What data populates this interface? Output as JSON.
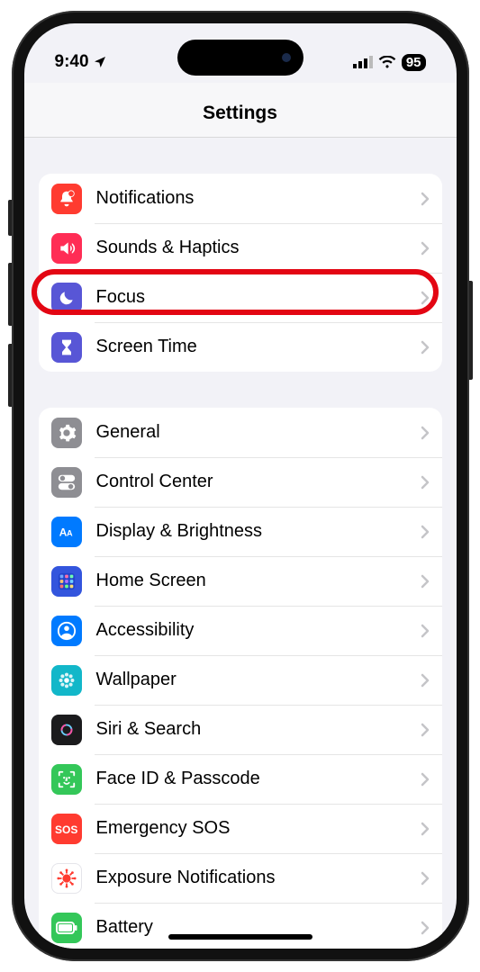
{
  "status": {
    "time": "9:40",
    "location_icon": "location-arrow",
    "battery_percent": "95"
  },
  "nav": {
    "title": "Settings"
  },
  "groups": [
    {
      "rows": [
        {
          "id": "notifications",
          "label": "Notifications",
          "icon": "bell",
          "bg": "#ff3b30"
        },
        {
          "id": "sounds",
          "label": "Sounds & Haptics",
          "icon": "speaker",
          "bg": "#ff2d55"
        },
        {
          "id": "focus",
          "label": "Focus",
          "icon": "moon",
          "bg": "#5856d6",
          "highlighted": true
        },
        {
          "id": "screentime",
          "label": "Screen Time",
          "icon": "hourglass",
          "bg": "#5856d6"
        }
      ]
    },
    {
      "rows": [
        {
          "id": "general",
          "label": "General",
          "icon": "gear",
          "bg": "#8e8e93"
        },
        {
          "id": "controlcenter",
          "label": "Control Center",
          "icon": "toggles",
          "bg": "#8e8e93"
        },
        {
          "id": "display",
          "label": "Display & Brightness",
          "icon": "aa",
          "bg": "#007aff"
        },
        {
          "id": "homescreen",
          "label": "Home Screen",
          "icon": "grid",
          "bg": "#3355dd"
        },
        {
          "id": "accessibility",
          "label": "Accessibility",
          "icon": "person-circle",
          "bg": "#007aff"
        },
        {
          "id": "wallpaper",
          "label": "Wallpaper",
          "icon": "flower",
          "bg": "#12b7c9"
        },
        {
          "id": "siri",
          "label": "Siri & Search",
          "icon": "siri",
          "bg": "#1b1b1d"
        },
        {
          "id": "faceid",
          "label": "Face ID & Passcode",
          "icon": "faceid",
          "bg": "#34c759"
        },
        {
          "id": "sos",
          "label": "Emergency SOS",
          "icon": "sos-text",
          "bg": "#ff3b30"
        },
        {
          "id": "exposure",
          "label": "Exposure Notifications",
          "icon": "virus",
          "bg": "#ffffff",
          "fg": "#ff3b30"
        },
        {
          "id": "battery",
          "label": "Battery",
          "icon": "battery",
          "bg": "#34c759"
        }
      ]
    }
  ]
}
